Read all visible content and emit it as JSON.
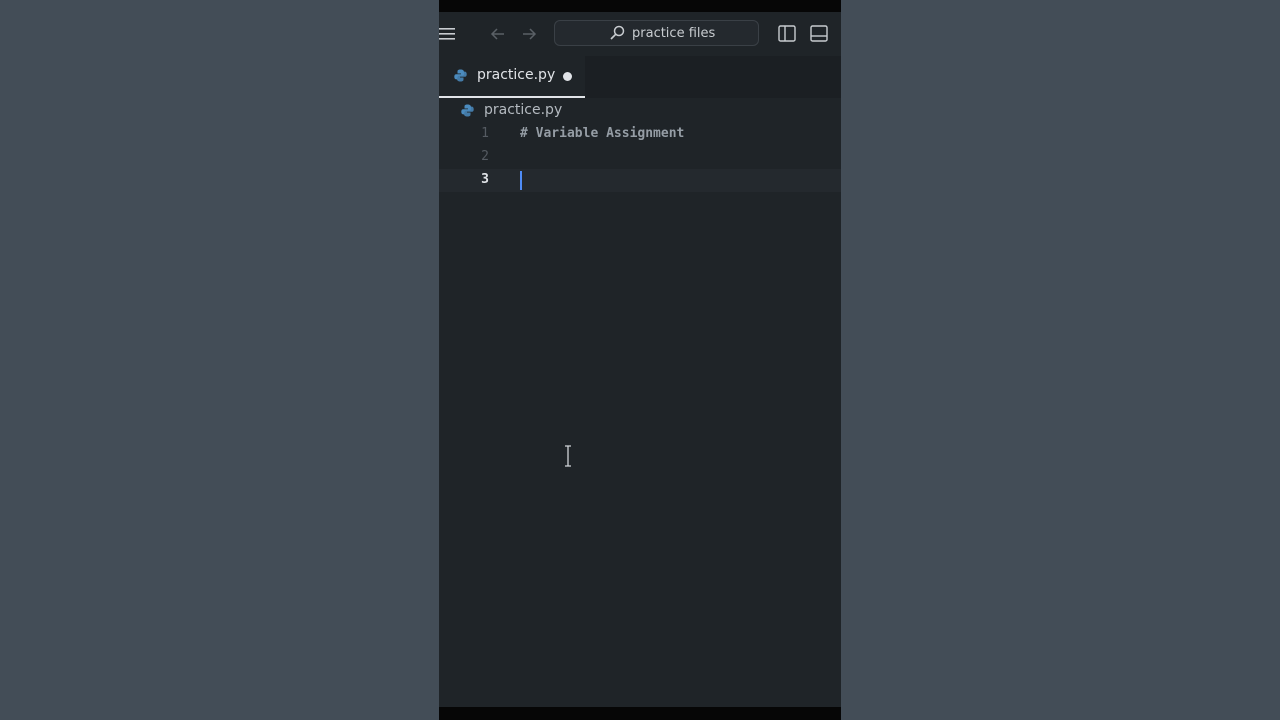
{
  "window": {
    "search": {
      "placeholder": "practice files"
    },
    "icons": [
      "menu-icon",
      "arrow-left-icon",
      "arrow-right-icon",
      "search-icon",
      "sidebar-toggle-icon",
      "panel-toggle-icon"
    ]
  },
  "tabs": [
    {
      "label": "practice.py",
      "icon": "python-icon",
      "modified": true,
      "active": true
    }
  ],
  "breadcrumb": {
    "label": "practice.py",
    "icon": "python-icon"
  },
  "editor": {
    "lines": [
      {
        "number": "1",
        "text": "# Variable Assignment"
      },
      {
        "number": "2",
        "text": ""
      },
      {
        "number": "3",
        "text": ""
      }
    ],
    "current_line": 3
  },
  "colors": {
    "editor_bg": "#1f2428",
    "tabbar_bg": "#1b1f23",
    "outer_bg": "#434d57",
    "caret": "#4f8cf7",
    "comment": "#959da5",
    "python_icon": "#4b8bbe"
  }
}
